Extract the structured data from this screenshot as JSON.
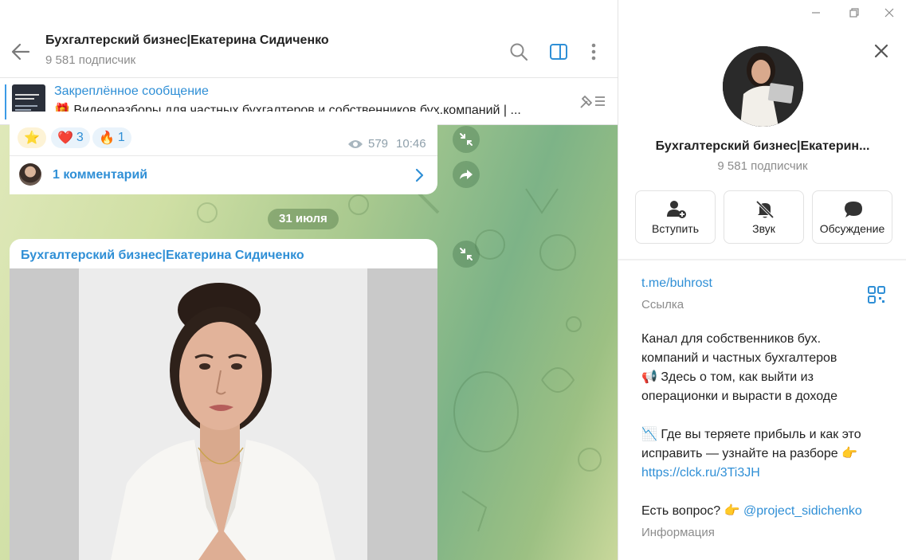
{
  "header": {
    "title": "Бухгалтерский бизнес|Екатерина Сидиченко",
    "subscribers": "9 581 подписчик"
  },
  "pinned": {
    "title": "Закреплённое сообщение",
    "emoji": "🎁",
    "text": "Видеоразборы для частных бухгалтеров и собственников бух.компаний |  ..."
  },
  "message1": {
    "reactions": [
      {
        "emoji": "⭐",
        "count": ""
      },
      {
        "emoji": "❤️",
        "count": "3"
      },
      {
        "emoji": "🔥",
        "count": "1"
      }
    ],
    "views": "579",
    "time": "10:46",
    "comments": "1 комментарий"
  },
  "date_separator": "31 июля",
  "message2": {
    "author": "Бухгалтерский бизнес|Екатерина Сидиченко"
  },
  "info": {
    "title": "Бухгалтерский бизнес|Екатерин...",
    "subscribers": "9 581 подписчик",
    "actions": [
      {
        "label": "Вступить",
        "icon": "add-user-icon"
      },
      {
        "label": "Звук",
        "icon": "bell-off-icon"
      },
      {
        "label": "Обсуждение",
        "icon": "chat-bubble-icon"
      }
    ],
    "link": "t.me/buhrost",
    "link_label": "Ссылка",
    "description": {
      "line1": "Канал для собственников бух.",
      "line2": "компаний  и частных бухгалтеров",
      "line3": "📢 Здесь о том, как выйти из",
      "line4": "операционки и вырасти в доходе",
      "line5": "📉 Где вы теряете прибыль и как это",
      "line6": "исправить — узнайте на разборе 👉",
      "url": "https://clck.ru/3Ti3JH",
      "question": "Есть вопрос? 👉 ",
      "mention": "@project_sidichenko"
    },
    "info_label": "Информация"
  },
  "colors": {
    "accent": "#2f8fd6",
    "text_secondary": "#8c8c8c"
  }
}
